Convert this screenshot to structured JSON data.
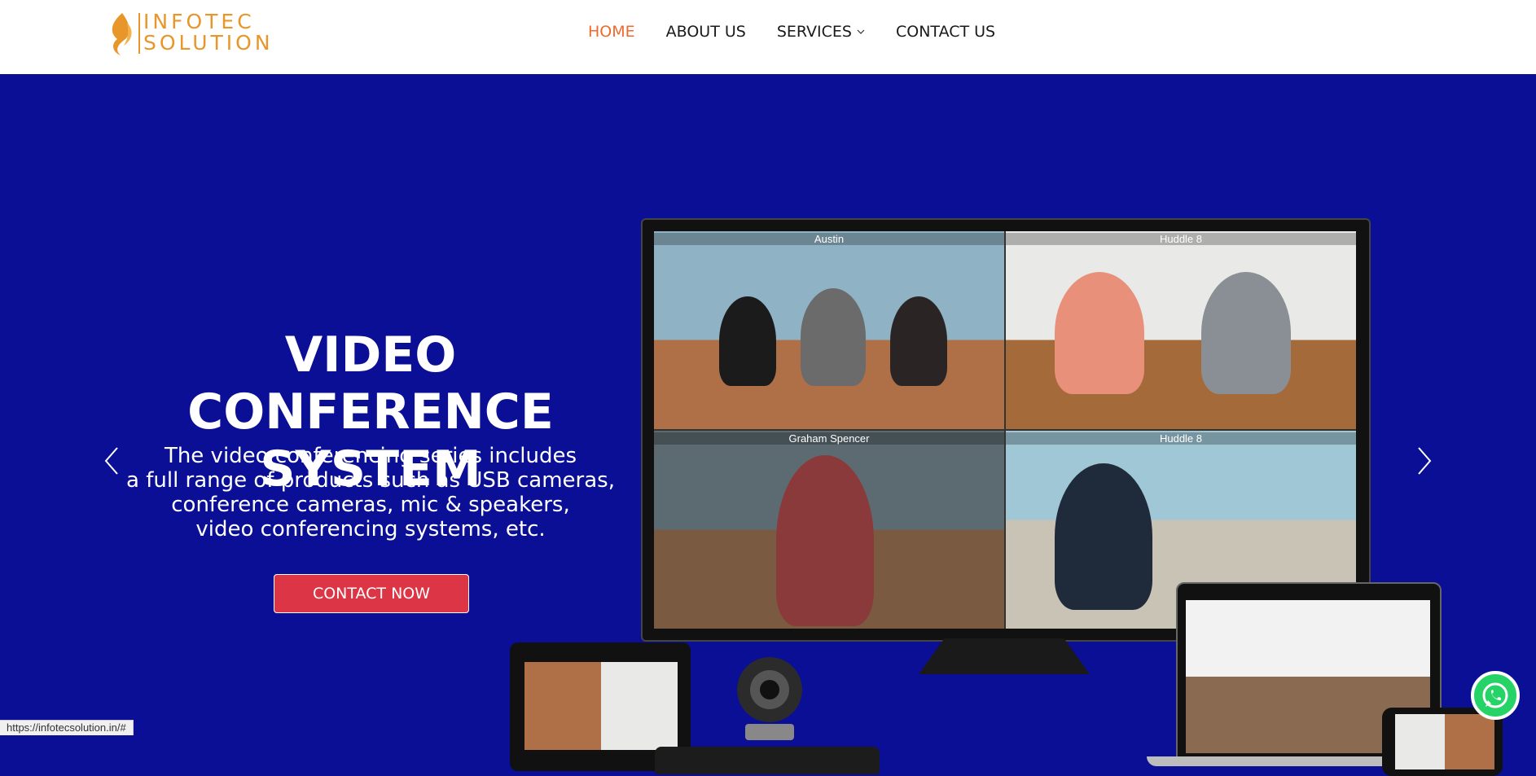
{
  "logo": {
    "line1": "INFOTEC",
    "line2": "SOLUTION",
    "color": "#e8962a"
  },
  "nav": {
    "items": [
      {
        "label": "HOME",
        "active": true
      },
      {
        "label": "ABOUT US"
      },
      {
        "label": "SERVICES",
        "dropdown": true
      },
      {
        "label": "CONTACT US"
      }
    ]
  },
  "hero": {
    "background": "#0a0f96",
    "title_line1": "VIDEO CONFERENCE",
    "title_line2": "SYSTEM",
    "description": "The video conferencing series includes\na full range of products such as USB cameras,\nconference cameras, mic & speakers,\nvideo conferencing systems, etc.",
    "cta_label": "CONTACT NOW",
    "tiles": [
      "Austin",
      "Huddle 8",
      "Graham Spencer",
      "Huddle 8"
    ]
  },
  "status_url": "https://infotecsolution.in/#"
}
